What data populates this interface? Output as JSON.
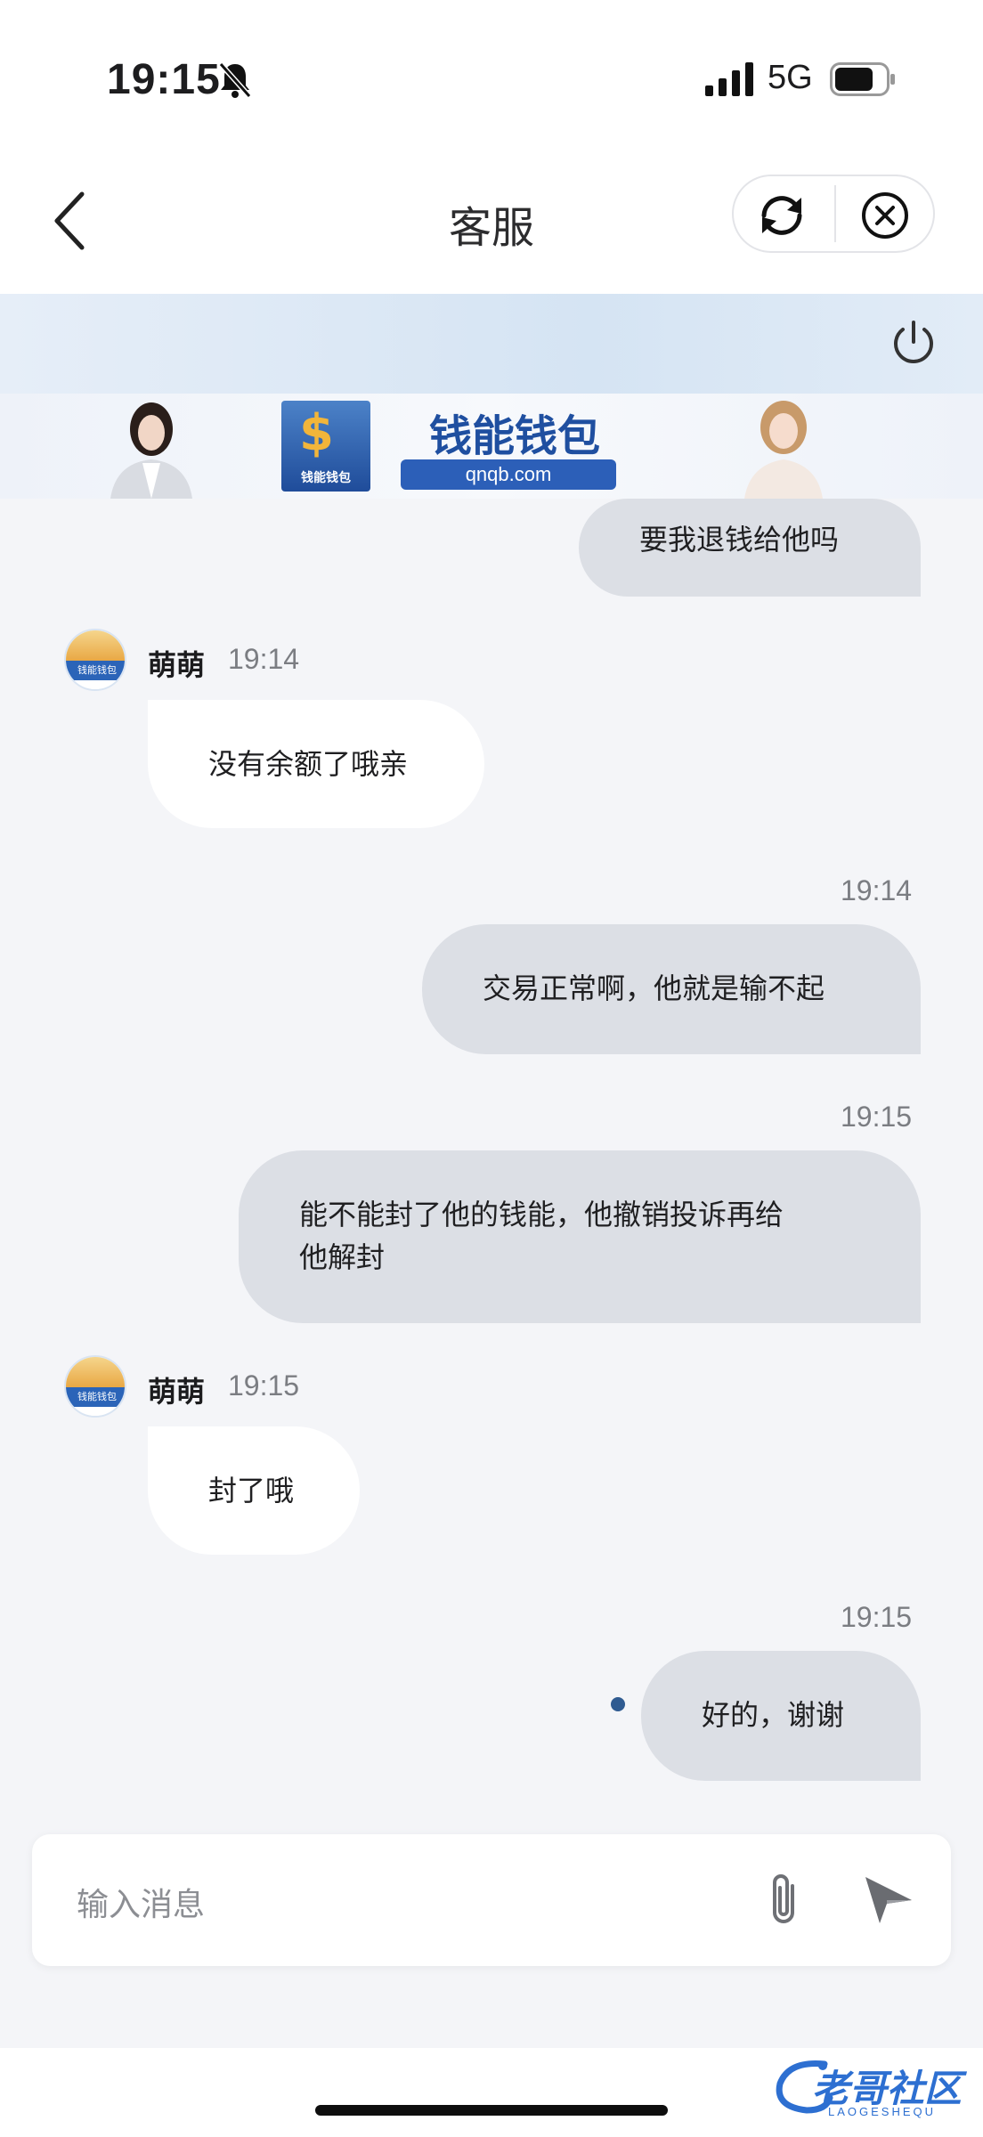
{
  "status_bar": {
    "time": "19:15",
    "network": "5G"
  },
  "nav": {
    "title": "客服"
  },
  "banner": {
    "brand_name": "钱能钱包",
    "brand_url": "qnqb.com",
    "logo_text": "钱能钱包"
  },
  "messages": {
    "m0": {
      "text": "要我退钱给他吗"
    },
    "m1": {
      "sender": "萌萌",
      "time": "19:14",
      "text": "没有余额了哦亲"
    },
    "m2": {
      "time": "19:14",
      "text": "交易正常啊，他就是输不起"
    },
    "m3": {
      "time": "19:15",
      "text_line1": "能不能封了他的钱能，他撤销投诉再给",
      "text_line2": "他解封"
    },
    "m4": {
      "sender": "萌萌",
      "time": "19:15",
      "text": "封了哦"
    },
    "m5": {
      "time": "19:15",
      "text": "好的，谢谢"
    }
  },
  "input": {
    "placeholder": "输入消息"
  },
  "watermark": {
    "text": "老哥社区",
    "sub": "LAOGESHEQU"
  },
  "colors": {
    "outgoing_bubble": "#dcdfe5",
    "incoming_bubble": "#ffffff",
    "background": "#f4f5f8",
    "brand_blue": "#2c5fb8"
  }
}
